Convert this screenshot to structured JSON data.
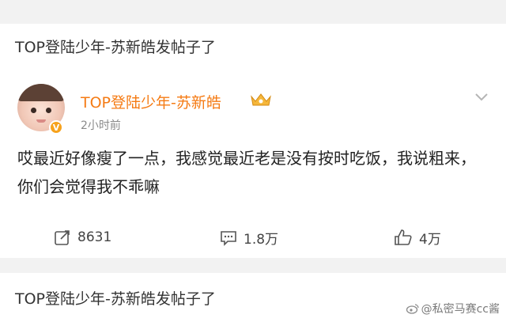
{
  "repost_header_top": {
    "title": "TOP登陆少年-苏新皓发帖子了"
  },
  "post": {
    "username": "TOP登陆少年-苏新皓",
    "time": "2小时前",
    "text": "哎最近好像瘦了一点，我感觉最近老是没有按时吃饭，我说粗来，你们会觉得我不乖嘛",
    "verified_badge": "V",
    "actions": {
      "repost_count": "8631",
      "comment_count": "1.8万",
      "like_count": "4万"
    }
  },
  "repost_header_bottom": {
    "title": "TOP登陆少年-苏新皓发帖子了"
  },
  "watermark": {
    "text": "@私密马赛cc酱"
  },
  "colors": {
    "username": "#f57b14",
    "badge": "#f7a21c"
  },
  "icons": [
    "vip-crown-icon",
    "chevron-down-icon",
    "repost-icon",
    "comment-icon",
    "like-icon",
    "weibo-logo-icon"
  ]
}
